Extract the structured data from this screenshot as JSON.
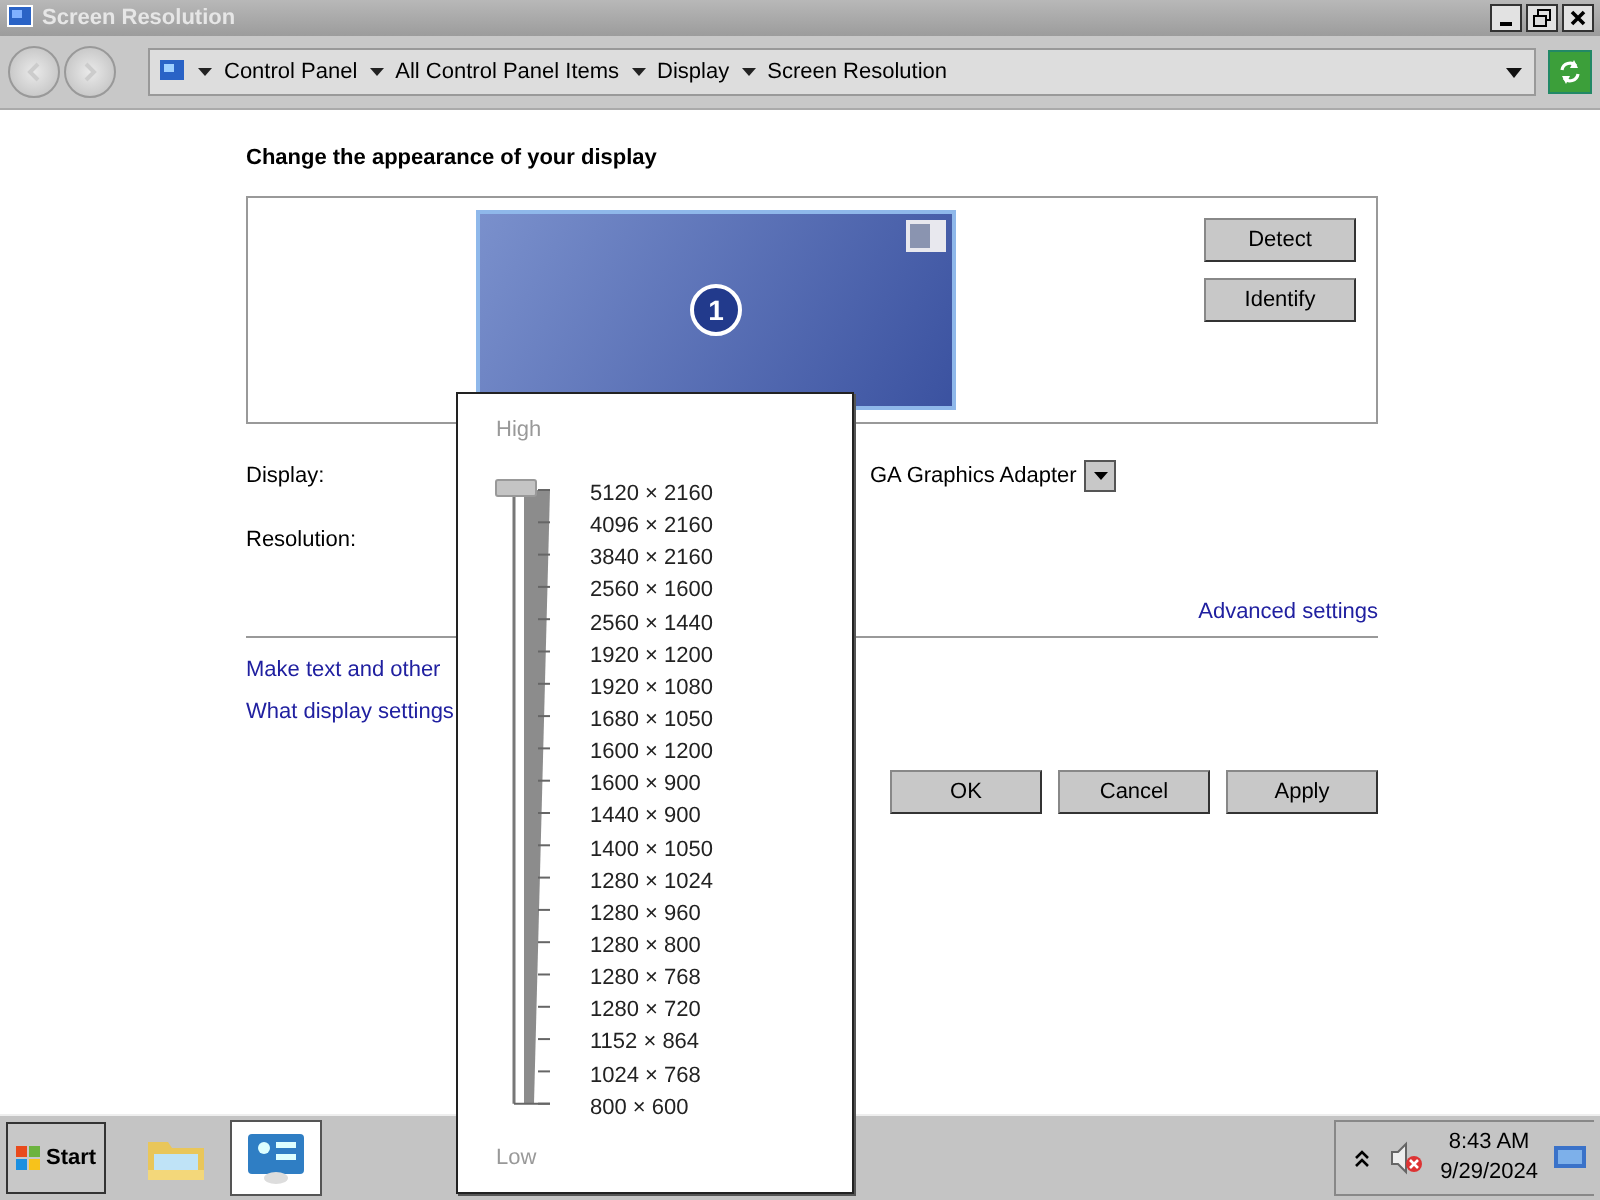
{
  "window": {
    "title": "Screen Resolution"
  },
  "breadcrumb": [
    "Control Panel",
    "All Control Panel Items",
    "Display",
    "Screen Resolution"
  ],
  "heading": "Change the appearance of your display",
  "monitor": {
    "number": "1"
  },
  "side_buttons": [
    "Detect",
    "Identify"
  ],
  "fields": [
    {
      "label": "Display:",
      "value": "GA Graphics Adapter"
    },
    {
      "label": "Resolution:"
    }
  ],
  "advanced_link": "Advanced settings",
  "links": [
    "Make text and other",
    "What display settings"
  ],
  "buttons": [
    "OK",
    "Cancel",
    "Apply"
  ],
  "resolution_popup": {
    "high_label": "High",
    "low_label": "Low",
    "level": 1,
    "options": [
      "5120 × 2160",
      "4096 × 2160",
      "3840 × 2160",
      "2560 × 1600",
      "2560 × 1440",
      "1920 × 1200",
      "1920 × 1080",
      "1680 × 1050",
      "1600 × 1200",
      "1600 × 900",
      "1440 × 900",
      "1400 × 1050",
      "1280 × 1024",
      "1280 × 960",
      "1280 × 800",
      "1280 × 768",
      "1280 × 720",
      "1152 × 864",
      "1024 × 768",
      "800 × 600"
    ]
  },
  "taskbar": {
    "start": "Start",
    "apps": [
      {
        "kind": "explorer",
        "active": false
      },
      {
        "kind": "control-panel",
        "active": true
      }
    ],
    "time": "8:43 AM",
    "date": "9/29/2024"
  }
}
